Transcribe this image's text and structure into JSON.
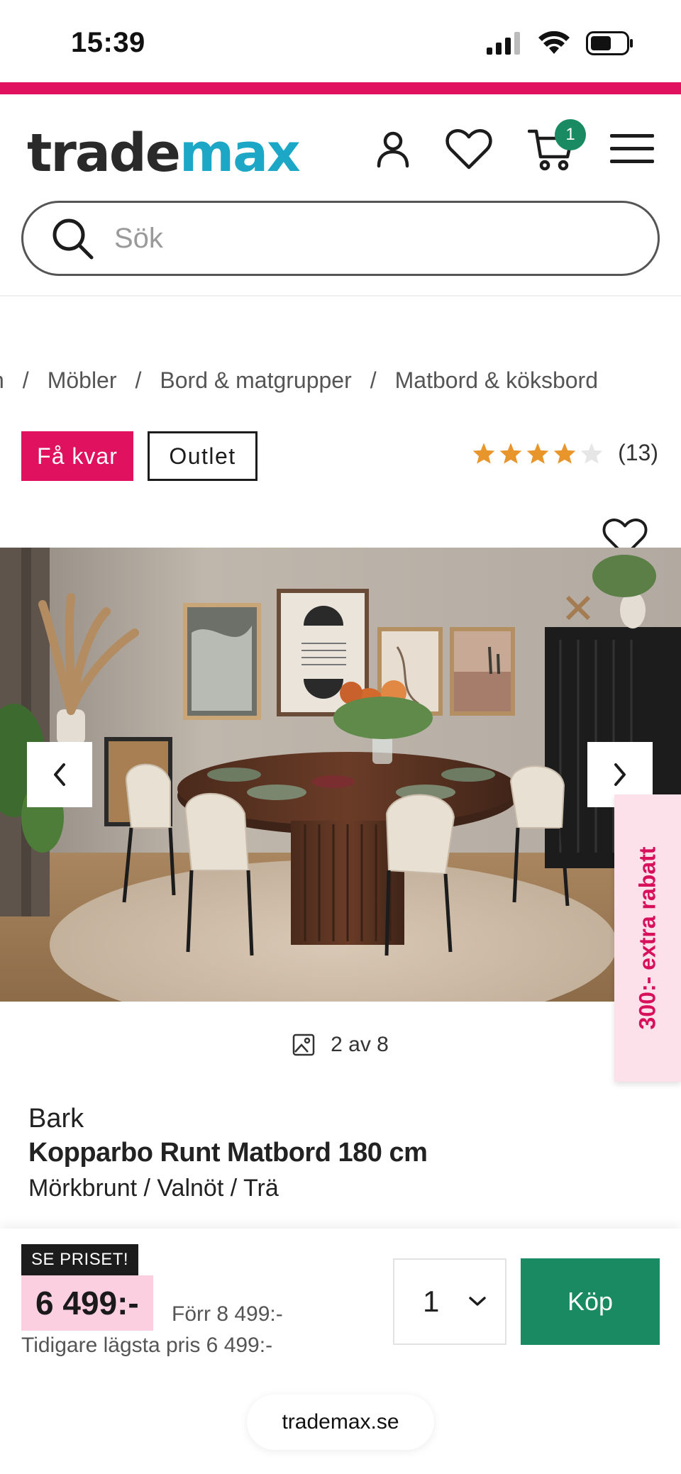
{
  "status_bar": {
    "time": "15:39"
  },
  "header": {
    "logo_part1": "trade",
    "logo_part2": "max",
    "cart_count": "1",
    "icons": [
      "account-icon",
      "wishlist-heart-icon",
      "cart-icon",
      "menu-icon"
    ]
  },
  "search": {
    "placeholder": "Sök",
    "value": ""
  },
  "breadcrumb": {
    "items": [
      "n",
      "Möbler",
      "Bord & matgrupper",
      "Matbord & köksbord"
    ],
    "separator": "/"
  },
  "badges": {
    "few_left": "Få kvar",
    "outlet": "Outlet"
  },
  "rating": {
    "stars": 4,
    "max": 5,
    "count": "(13)"
  },
  "gallery": {
    "counter": "2 av 8"
  },
  "promo_tab": "300:- extra rabatt",
  "product": {
    "brand": "Bark",
    "name": "Kopparbo Runt Matbord 180 cm",
    "variant": "Mörkbrunt / Valnöt / Trä"
  },
  "purchase": {
    "price_badge": "SE PRISET!",
    "price": "6 499:-",
    "was_price": "Förr 8 499:-",
    "lowest_price": "Tidigare lägsta pris 6 499:-",
    "quantity": "1",
    "buy_label": "Köp"
  },
  "browser": {
    "url": "trademax.se"
  },
  "colors": {
    "accent_pink": "#e0115f",
    "brand_teal": "#1ba7c5",
    "buy_green": "#1a8a63",
    "price_bg": "#fbcfe0",
    "star": "#e8962c"
  }
}
